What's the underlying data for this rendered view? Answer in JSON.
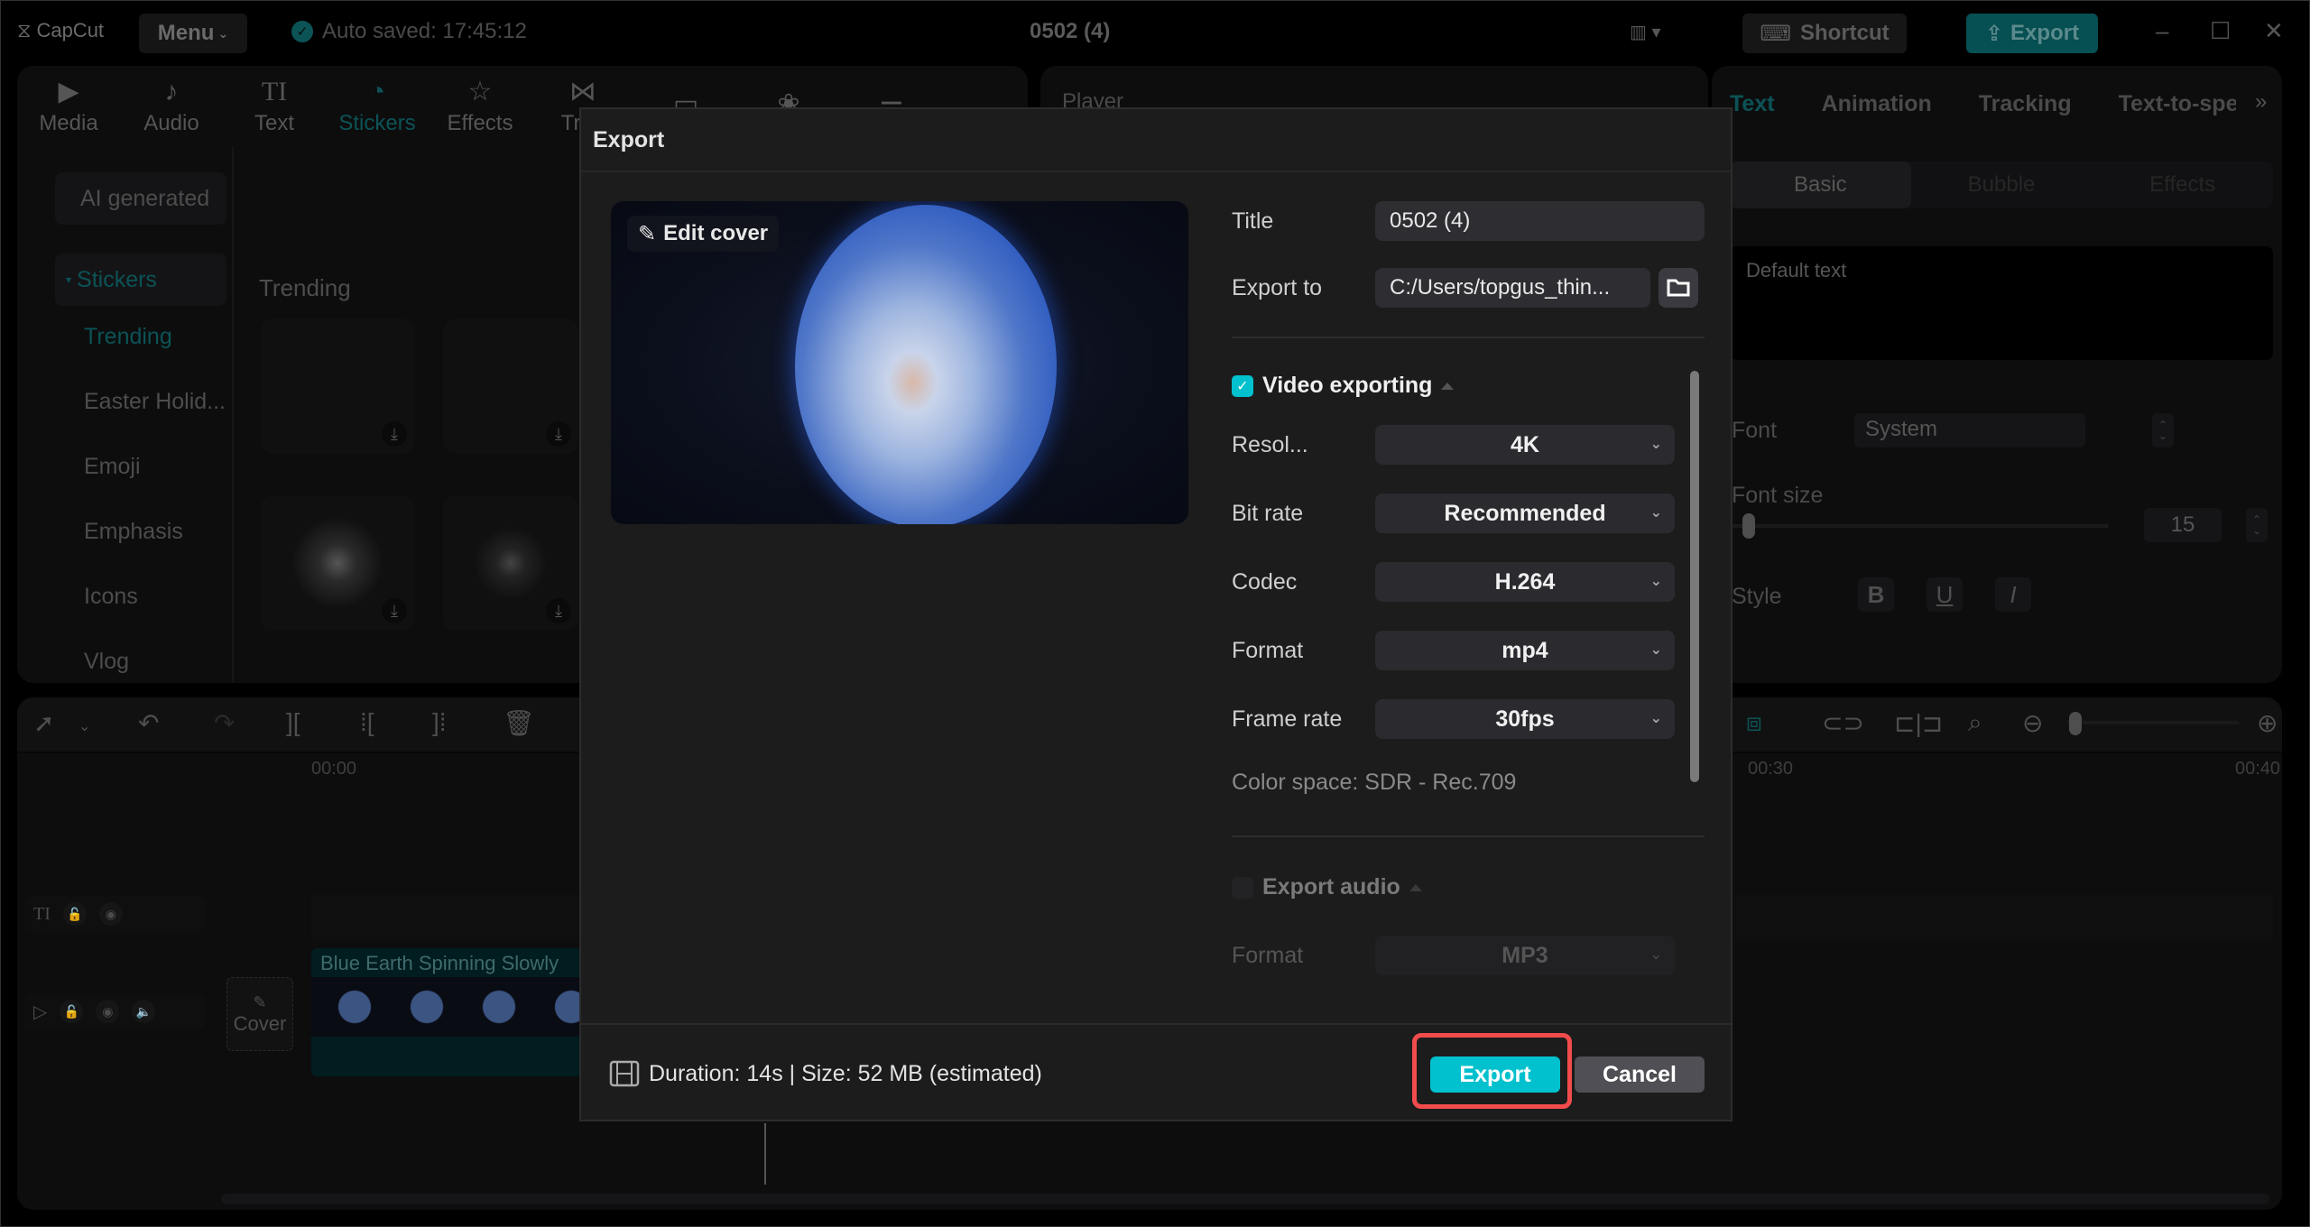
{
  "app": {
    "logo": "CapCut",
    "menu_label": "Menu",
    "autosave": "Auto saved: 17:45:12",
    "project_title": "0502 (4)",
    "shortcut_label": "Shortcut",
    "export_label": "Export",
    "accent_color": "#00c1cd",
    "highlight_color": "#f24b4b"
  },
  "tool_tabs": [
    {
      "label": "Media",
      "icon": "media-icon",
      "glyph": "▶"
    },
    {
      "label": "Audio",
      "icon": "audio-icon",
      "glyph": "♪"
    },
    {
      "label": "Text",
      "icon": "text-icon",
      "glyph": "TI"
    },
    {
      "label": "Stickers",
      "icon": "sticker-icon",
      "glyph": "◔",
      "active": true
    },
    {
      "label": "Effects",
      "icon": "effects-icon",
      "glyph": "☆"
    },
    {
      "label": "Tran",
      "icon": "transitions-icon",
      "glyph": "⋈"
    },
    {
      "label": "",
      "icon": "captions-icon",
      "glyph": "▭"
    },
    {
      "label": "",
      "icon": "filters-icon",
      "glyph": "❀"
    },
    {
      "label": "",
      "icon": "adjust-icon",
      "glyph": "⚌"
    }
  ],
  "sidebar": {
    "ai_generated": "AI generated",
    "stickers": "Stickers",
    "items": [
      "Trending",
      "Easter Holid...",
      "Emoji",
      "Emphasis",
      "Icons",
      "Vlog"
    ]
  },
  "sticker_section": "Trending",
  "player": {
    "label": "Player"
  },
  "right_panel": {
    "tabs": [
      "Text",
      "Animation",
      "Tracking",
      "Text-to-spe"
    ],
    "segments": [
      "Basic",
      "Bubble",
      "Effects"
    ],
    "default_text": "Default text",
    "font_label": "Font",
    "font_value": "System",
    "font_size_label": "Font size",
    "font_size_value": "15",
    "style_label": "Style",
    "style_buttons": [
      "B",
      "U",
      "I"
    ]
  },
  "timeline": {
    "ruler": [
      "00:00",
      "00:30",
      "00:40"
    ],
    "clip_title": "Blue Earth Spinning Slowly",
    "cover_label": "Cover"
  },
  "dialog": {
    "title": "Export",
    "edit_cover": "Edit cover",
    "title_label": "Title",
    "title_value": "0502 (4)",
    "export_to_label": "Export to",
    "export_to_value": "C:/Users/topgus_thin...",
    "video_section": "Video exporting",
    "video_enabled": true,
    "fields": [
      {
        "label": "Resol...",
        "value": "4K"
      },
      {
        "label": "Bit rate",
        "value": "Recommended"
      },
      {
        "label": "Codec",
        "value": "H.264"
      },
      {
        "label": "Format",
        "value": "mp4"
      },
      {
        "label": "Frame rate",
        "value": "30fps"
      }
    ],
    "color_space": "Color space: SDR - Rec.709",
    "audio_section": "Export audio",
    "audio_enabled": false,
    "audio_format_label": "Format",
    "audio_format_value": "MP3",
    "footer_info": "Duration: 14s | Size: 52 MB (estimated)",
    "export_button": "Export",
    "cancel_button": "Cancel"
  }
}
